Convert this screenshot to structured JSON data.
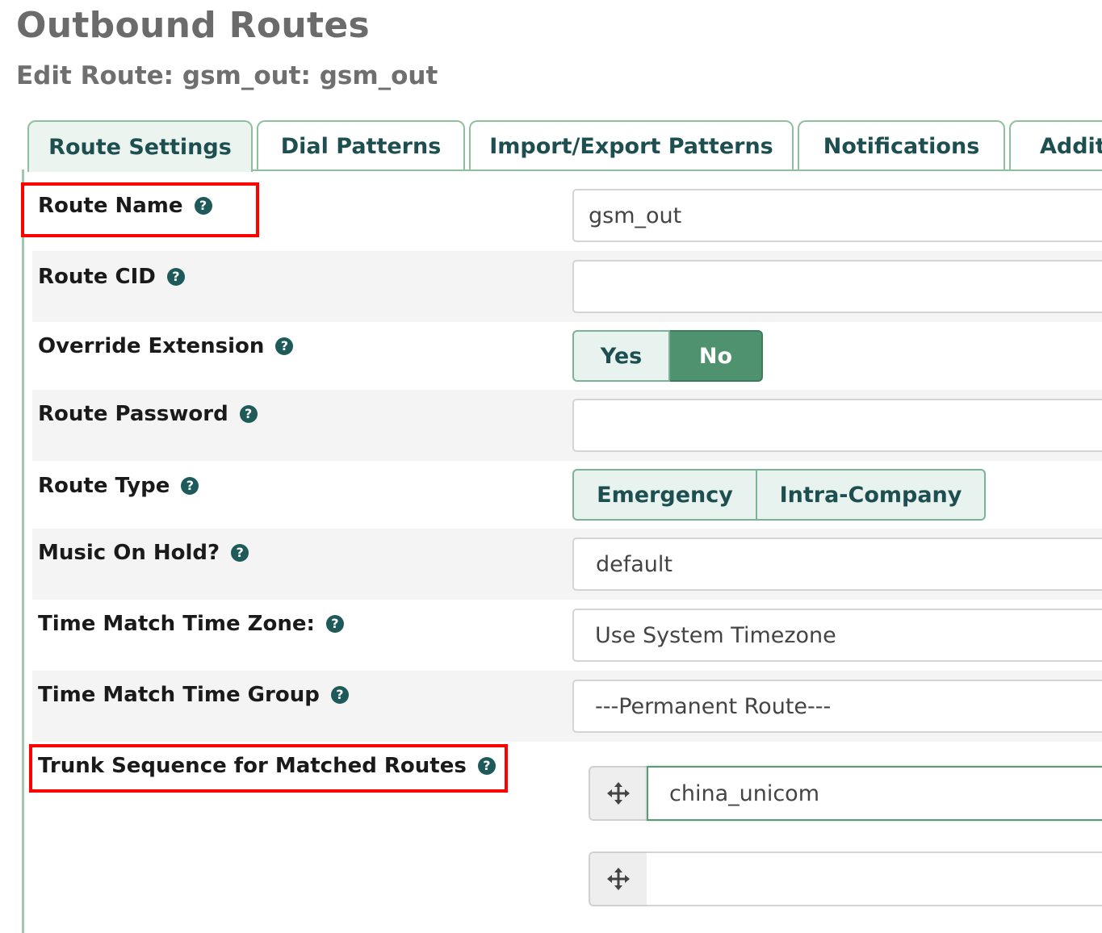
{
  "page": {
    "title": "Outbound Routes",
    "subtitle": "Edit Route: gsm_out: gsm_out"
  },
  "tabs": [
    {
      "label": "Route Settings",
      "active": true
    },
    {
      "label": "Dial Patterns",
      "active": false
    },
    {
      "label": "Import/Export Patterns",
      "active": false
    },
    {
      "label": "Notifications",
      "active": false
    },
    {
      "label": "Addit",
      "active": false
    }
  ],
  "form": {
    "route_name": {
      "label": "Route Name",
      "value": "gsm_out"
    },
    "route_cid": {
      "label": "Route CID",
      "value": ""
    },
    "override_extension": {
      "label": "Override Extension",
      "options": [
        "Yes",
        "No"
      ],
      "selected": "No"
    },
    "route_password": {
      "label": "Route Password",
      "value": ""
    },
    "route_type": {
      "label": "Route Type",
      "options": [
        "Emergency",
        "Intra-Company"
      ]
    },
    "music_on_hold": {
      "label": "Music On Hold?",
      "value": "default"
    },
    "time_zone": {
      "label": "Time Match Time Zone:",
      "value": "Use System Timezone"
    },
    "time_group": {
      "label": "Time Match Time Group",
      "value": "---Permanent Route---"
    },
    "trunk_sequence": {
      "label": "Trunk Sequence for Matched Routes",
      "trunks": [
        "china_unicom",
        ""
      ]
    }
  },
  "help_glyph": "?",
  "icons": {
    "help": "question-circle-icon",
    "drag": "move-arrows-icon"
  },
  "colors": {
    "accent": "#4f9270",
    "tab_text": "#1d4f50",
    "highlight": "#ff0000",
    "help_icon": "#1e5a5a"
  }
}
